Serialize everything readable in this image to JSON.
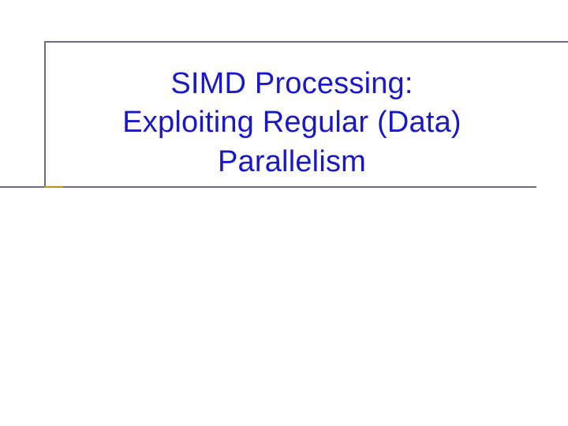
{
  "slide": {
    "title_line1": "SIMD Processing:",
    "title_line2": "Exploiting Regular (Data)",
    "title_line3": "Parallelism"
  }
}
